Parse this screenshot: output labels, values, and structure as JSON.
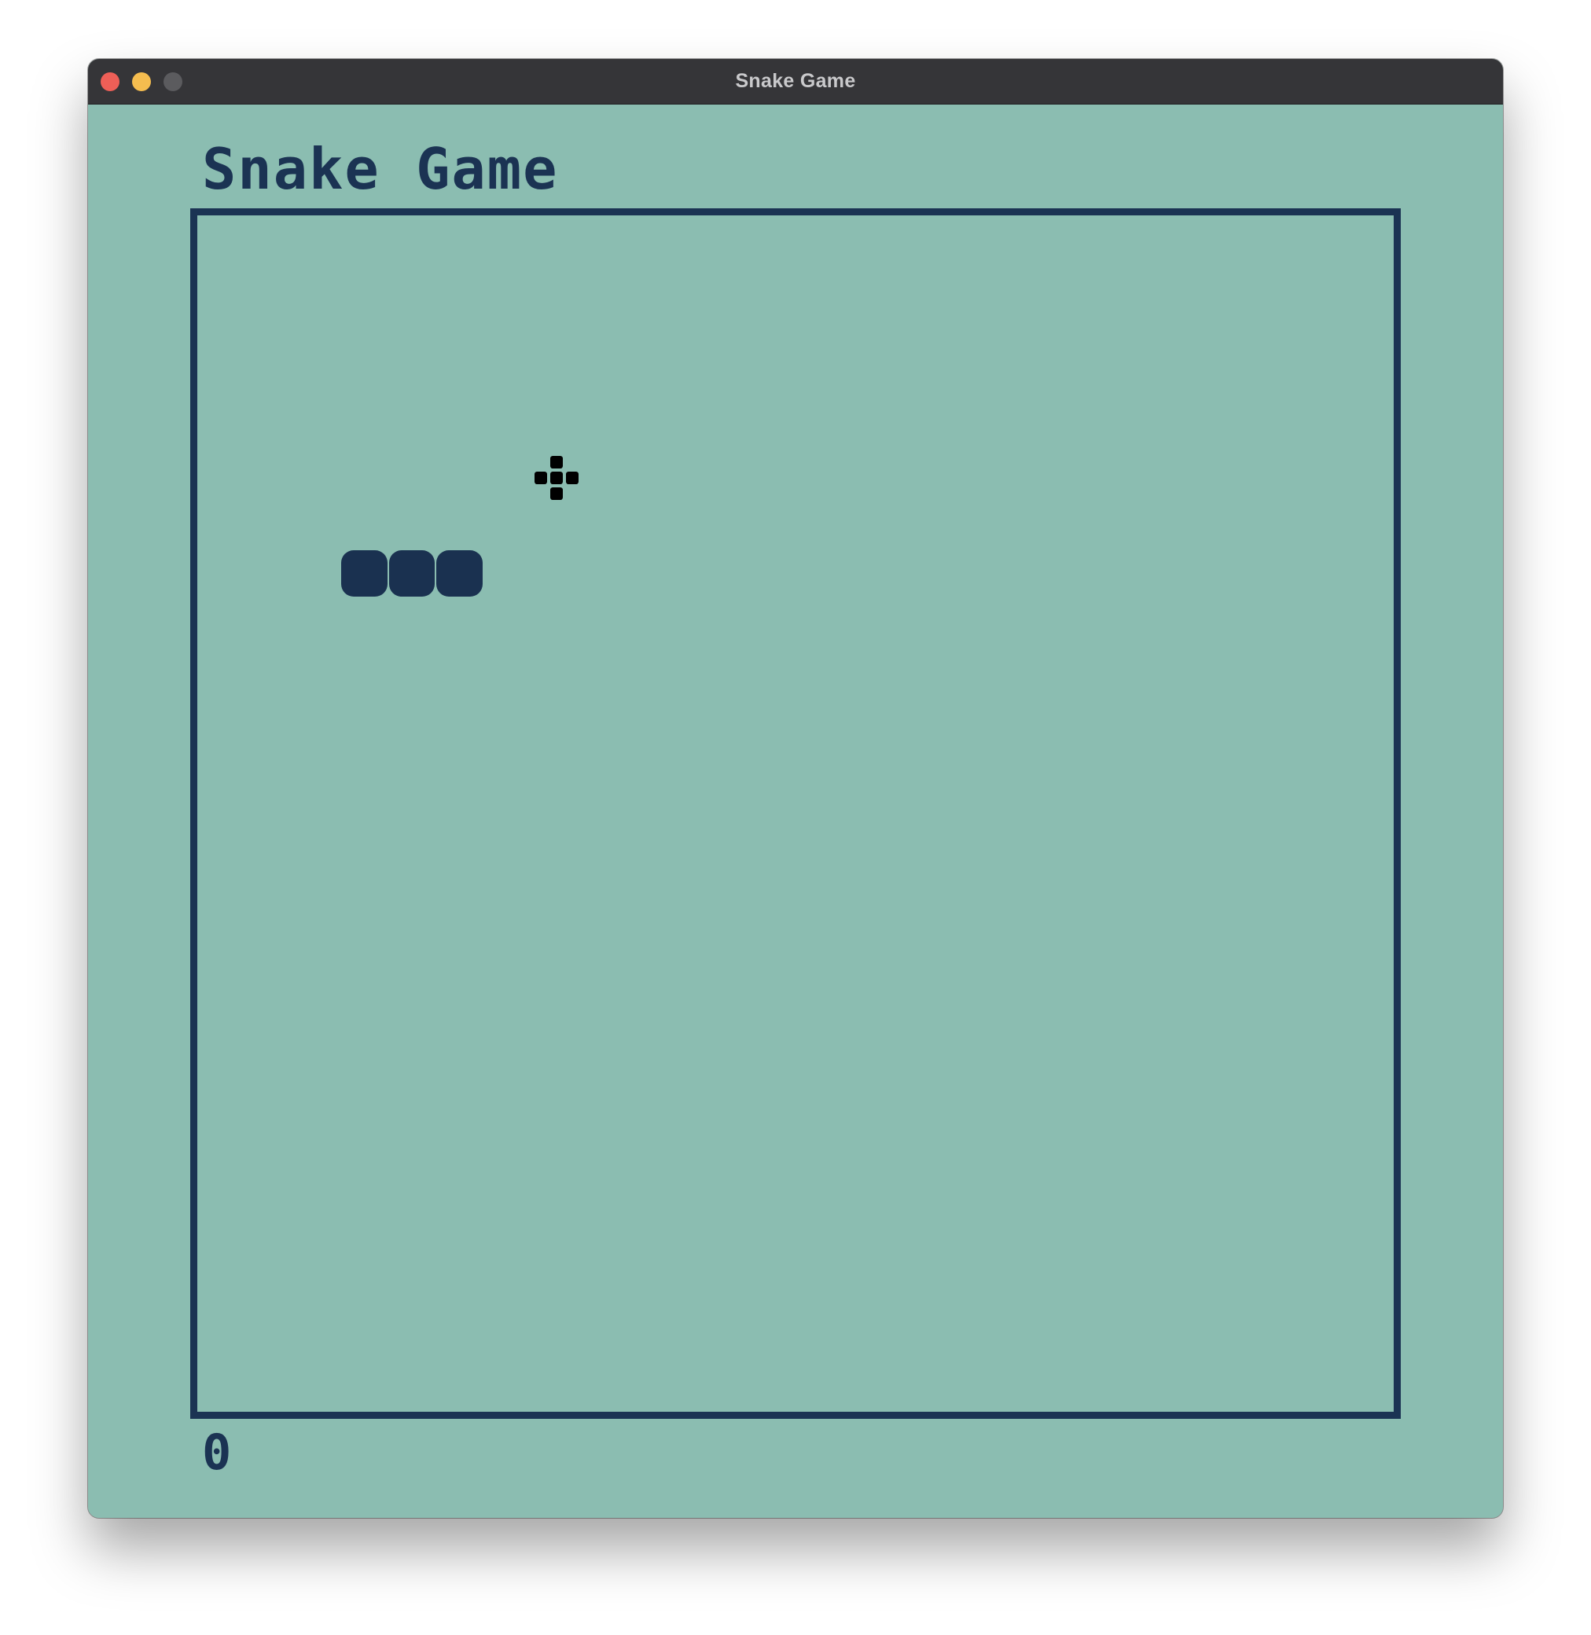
{
  "window": {
    "title": "Snake Game",
    "controls": [
      "close",
      "minimize",
      "zoom"
    ]
  },
  "game": {
    "title": "Snake Game",
    "score": "0",
    "colors": {
      "background": "#8bbdb1",
      "foreground": "#1b3353",
      "snake": "#1a3150",
      "food": "#000000"
    },
    "grid": {
      "cols": 25,
      "rows": 25
    },
    "snake": [
      {
        "col": 3,
        "row": 7
      },
      {
        "col": 4,
        "row": 7
      },
      {
        "col": 5,
        "row": 7
      }
    ],
    "food": {
      "col": 7,
      "row": 5,
      "icon": "plus-food-icon"
    }
  }
}
